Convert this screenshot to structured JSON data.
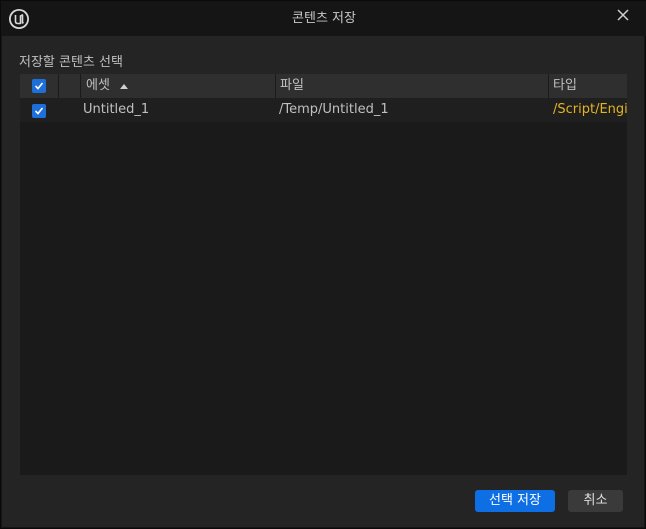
{
  "window": {
    "title": "콘텐츠 저장"
  },
  "section": {
    "label": "저장할 콘텐츠 선택"
  },
  "table": {
    "header_checked": true,
    "columns": [
      {
        "key": "asset",
        "label": "에셋",
        "sort": "ascending"
      },
      {
        "key": "file",
        "label": "파일"
      },
      {
        "key": "type",
        "label": "타입"
      }
    ],
    "rows": [
      {
        "checked": true,
        "asset": "Untitled_1",
        "file": "/Temp/Untitled_1",
        "type": "/Script/Engir"
      }
    ]
  },
  "buttons": {
    "save_selected": "선택 저장",
    "cancel": "취소"
  },
  "colors": {
    "accent": "#0e6fe4",
    "type_text": "#e3b422",
    "panel_bg": "#242424",
    "table_bg": "#1a1a1a"
  },
  "icons": [
    "unreal-logo-icon",
    "close-icon",
    "checkmark-icon",
    "sort-ascending-icon"
  ]
}
